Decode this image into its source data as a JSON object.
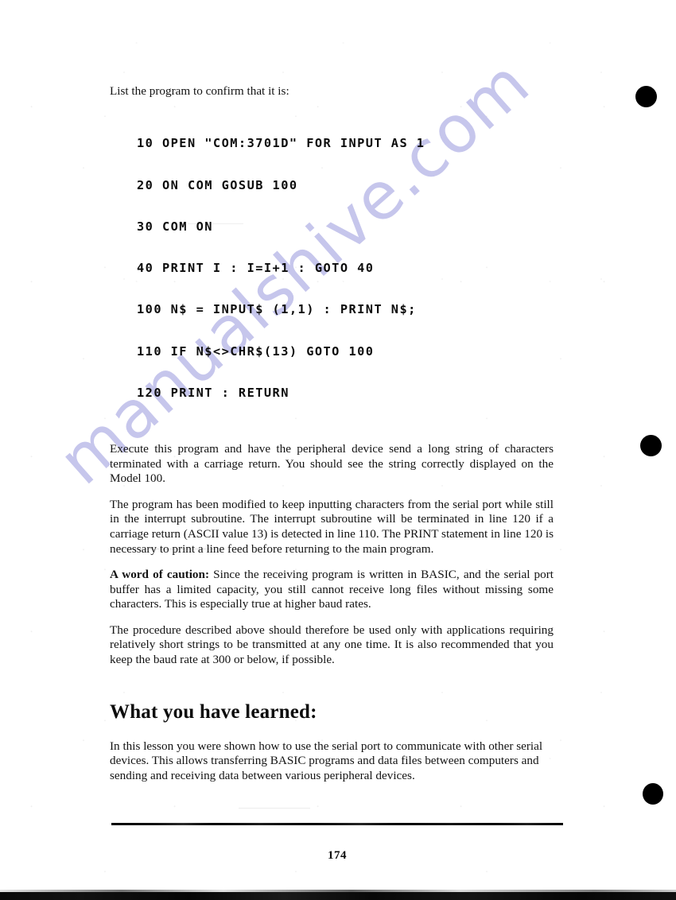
{
  "document": {
    "page_number": "174",
    "watermark": "manualshive.com",
    "watermark_color": "#c6c6ec"
  },
  "content": {
    "intro": "List the program to confirm that it is:",
    "code_listing": [
      "10 OPEN \"COM:3701D\" FOR INPUT AS 1",
      "20 ON COM GOSUB 100",
      "30 COM ON",
      "40 PRINT I : I=I+1 : GOTO 40",
      "100 N$ = INPUT$ (1,1) : PRINT N$;",
      "110 IF N$<>CHR$(13) GOTO 100",
      "120 PRINT : RETURN"
    ],
    "paragraph_1": "Execute this program and have the peripheral device send a long string of characters terminated with a carriage return. You should see the string correctly displayed on the Model 100.",
    "paragraph_2": "The program has been modified to keep inputting characters from the serial port while still in the interrupt subroutine. The interrupt subroutine will be terminated in line 120 if a carriage return (ASCII value 13) is detected in line 110. The PRINT statement in line 120 is necessary to print a line feed before returning to the main program.",
    "caution_label": "A word of caution:",
    "caution_text": " Since the receiving program is written in BASIC, and the serial port buffer has a limited capacity, you still cannot receive long files without missing some characters. This is especially true at higher baud rates.",
    "paragraph_3": "The procedure described above should therefore be used only with applications requiring relatively short strings to be transmitted at any one time. It is also recommended that you keep the baud rate at 300 or below, if possible.",
    "section_heading": "What you have learned:",
    "summary": "In this lesson you were shown how to use the serial port to communicate with other serial devices. This allows transferring BASIC programs and data files between computers and sending and receiving data between various peripheral devices."
  }
}
